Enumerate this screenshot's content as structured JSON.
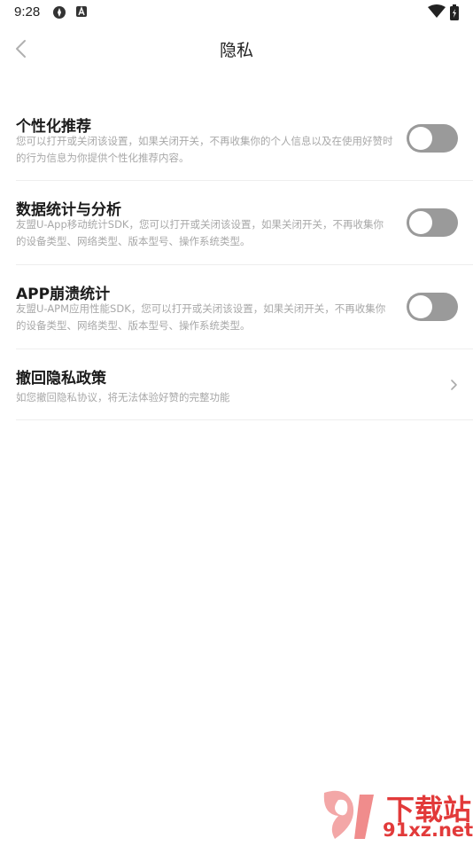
{
  "status_bar": {
    "time": "9:28"
  },
  "header": {
    "title": "隐私"
  },
  "settings": [
    {
      "title": "个性化推荐",
      "description": "您可以打开或关闭该设置，如果关闭开关，不再收集你的个人信息以及在使用好赞时的行为信息为你提供个性化推荐内容。",
      "control": "toggle",
      "enabled": false
    },
    {
      "title": "数据统计与分析",
      "description": "友盟U-App移动统计SDK，您可以打开或关闭该设置，如果关闭开关，不再收集你的设备类型、网络类型、版本型号、操作系统类型。",
      "control": "toggle",
      "enabled": false
    },
    {
      "title": "APP崩溃统计",
      "description": "友盟U-APM应用性能SDK，您可以打开或关闭该设置，如果关闭开关，不再收集你的设备类型、网络类型、版本型号、操作系统类型。",
      "control": "toggle",
      "enabled": false
    },
    {
      "title": "撤回隐私政策",
      "description": "如您撤回隐私协议，将无法体验好赞的完整功能",
      "control": "chevron"
    }
  ],
  "watermark": {
    "name": "下载站",
    "domain": "91xz.net"
  },
  "colors": {
    "toggle_off": "#9a9a9a",
    "divider": "#eeeeee",
    "description": "#a8a8a8",
    "watermark": "#e23a3a"
  }
}
